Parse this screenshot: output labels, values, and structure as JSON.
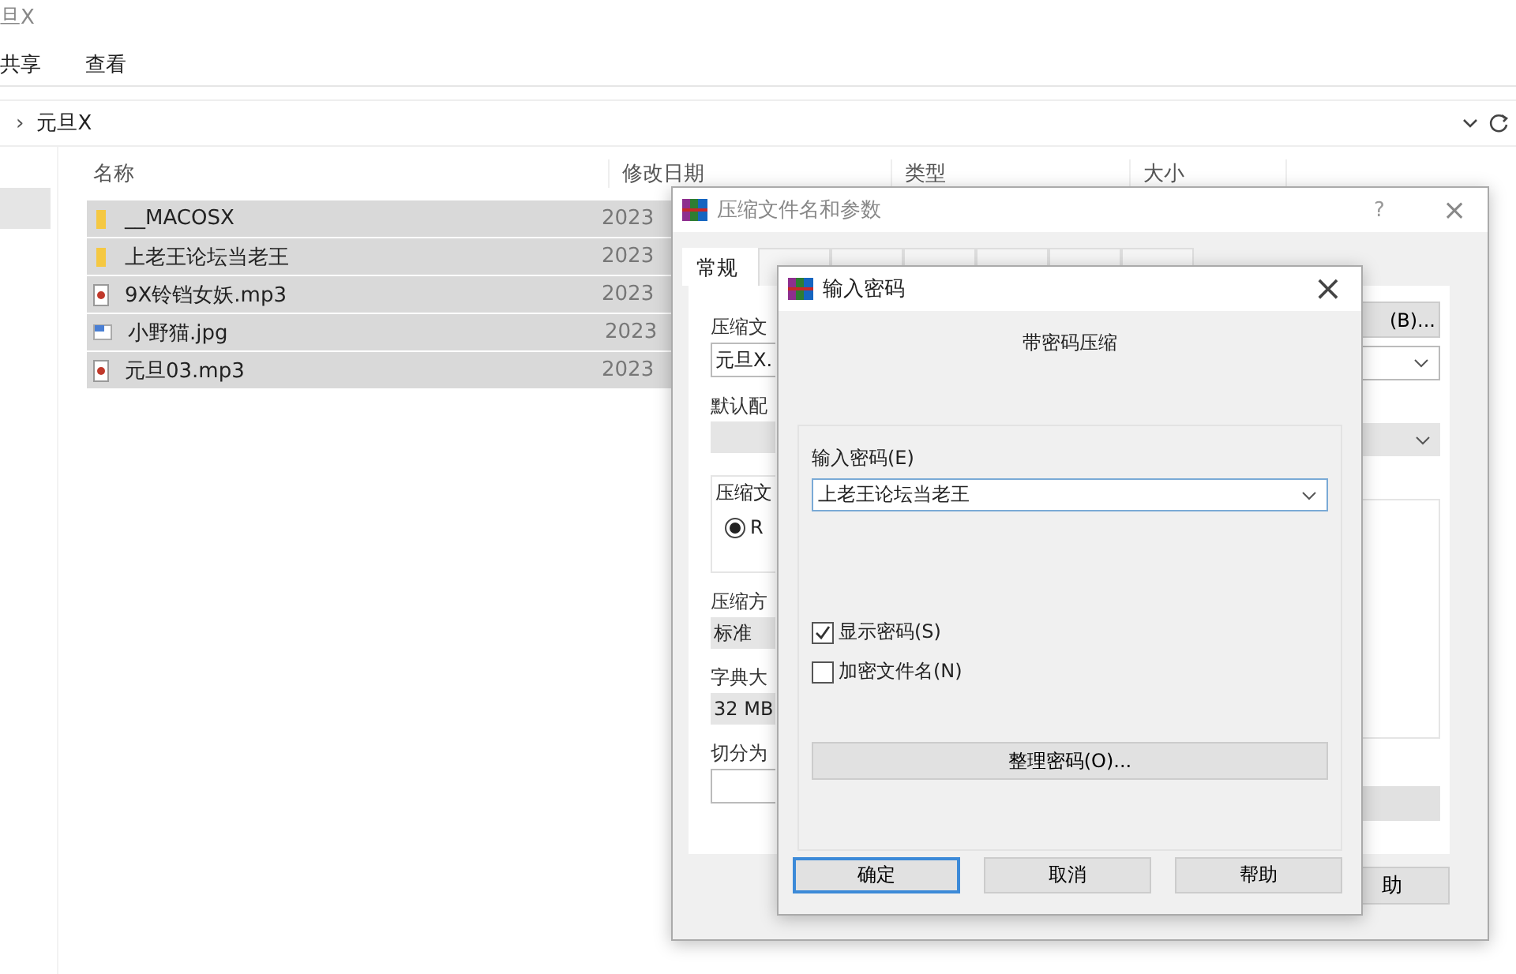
{
  "explorer": {
    "title": "旦X",
    "ribbon_tabs": [
      "共享",
      "查看"
    ],
    "breadcrumb": {
      "separator": "›",
      "folder": "元旦X"
    },
    "nav_items": [
      {
        "selected": true
      }
    ],
    "columns": [
      "名称",
      "修改日期",
      "类型",
      "大小"
    ],
    "files": [
      {
        "name": "__MACOSX",
        "kind": "folder",
        "date": "2023",
        "selected": true
      },
      {
        "name": "上老王论坛当老王",
        "kind": "folder",
        "date": "2023",
        "selected": true
      },
      {
        "name": "9X铃铛女妖.mp3",
        "kind": "audio",
        "date": "2023",
        "selected": true
      },
      {
        "name": "小野猫.jpg",
        "kind": "image",
        "date": "2023",
        "selected": true
      },
      {
        "name": "元旦03.mp3",
        "kind": "audio",
        "date": "2023",
        "selected": true
      }
    ]
  },
  "archive_dialog": {
    "title": "压缩文件名和参数",
    "help": "?",
    "close": "×",
    "tabs": [
      {
        "label": "常规",
        "selected": true
      },
      {
        "selected": false
      },
      {
        "selected": false
      },
      {
        "selected": false
      },
      {
        "selected": false
      },
      {
        "selected": false
      },
      {
        "selected": false
      }
    ],
    "left": {
      "name_label": "压缩文",
      "name_value": "元旦X.",
      "profile_label": "默认配",
      "format_group": "压缩文",
      "format_radio": {
        "label": "R",
        "checked": true
      },
      "method_label": "压缩方",
      "method_value": "标准",
      "dict_label": "字典大",
      "dict_value": "32 MB",
      "split_label": "切分为"
    },
    "right": {
      "browse_button": "(B)...",
      "help_button": "助"
    }
  },
  "password_dialog": {
    "title": "输入密码",
    "close": "×",
    "heading": "带密码压缩",
    "password_label": "输入密码(E)",
    "password_value": "上老王论坛当老王",
    "options": [
      {
        "label": "显示密码(S)",
        "checked": true
      },
      {
        "label": "加密文件名(N)",
        "checked": false
      }
    ],
    "organize_button": "整理密码(O)...",
    "buttons": [
      {
        "label": "确定",
        "default": true
      },
      {
        "label": "取消",
        "default": false
      },
      {
        "label": "帮助",
        "default": false
      }
    ]
  }
}
